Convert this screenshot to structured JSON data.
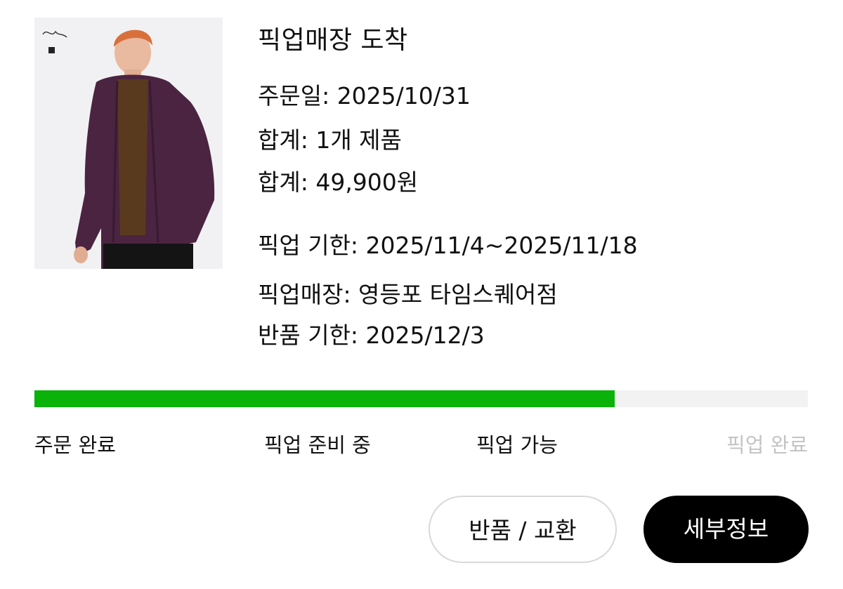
{
  "order": {
    "status_title": "픽업매장 도착",
    "order_date": "주문일: 2025/10/31",
    "total_items": "합계: 1개 제품",
    "total_price": "합계: 49,900원",
    "pickup_deadline": "픽업 기한: 2025/11/4~2025/11/18",
    "pickup_store": "픽업매장: 영등포 타임스퀘어점",
    "return_deadline": "반품 기한: 2025/12/3"
  },
  "progress": {
    "fraction": 0.75,
    "fill_color": "#0ab20a",
    "track_color": "#f2f2f2",
    "steps": [
      {
        "label": "주문 완료",
        "done": true
      },
      {
        "label": "픽업 준비 중",
        "done": true
      },
      {
        "label": "픽업 가능",
        "done": true
      },
      {
        "label": "픽업 완료",
        "done": false
      }
    ]
  },
  "actions": {
    "return_exchange": "반품 / 교환",
    "details": "세부정보"
  },
  "image": {
    "description_icon": "product-photo",
    "garment_color": "#4a2440",
    "sweater_color": "#5a3a1e",
    "hair_color": "#d9703c"
  }
}
